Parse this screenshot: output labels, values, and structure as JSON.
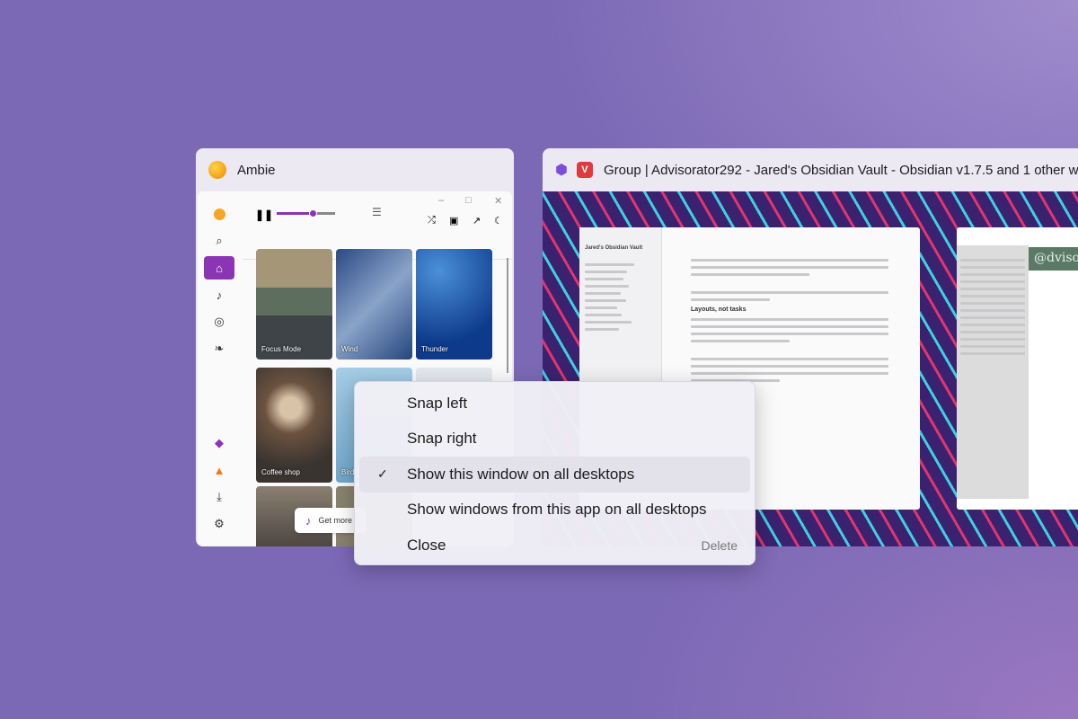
{
  "ambie": {
    "title": "Ambie",
    "tiles": [
      {
        "label": "Focus Mode"
      },
      {
        "label": "Wind"
      },
      {
        "label": "Thunder"
      },
      {
        "label": "Coffee shop"
      },
      {
        "label": "Bird"
      }
    ],
    "get_more": "Get more",
    "accent": "#8b35b5"
  },
  "obsidian": {
    "title": "Group | Advisorator292 - Jared's Obsidian Vault - Obsidian v1.7.5 and 1 other w",
    "vault": "Jared's Obsidian Vault",
    "heading": "Layouts, not tasks",
    "vivaldi_banner": "@dvisor"
  },
  "menu": {
    "items": [
      {
        "label": "Snap left"
      },
      {
        "label": "Snap right"
      },
      {
        "label": "Show this window on all desktops",
        "checked": true
      },
      {
        "label": "Show windows from this app on all desktops"
      },
      {
        "label": "Close",
        "accelerator": "Delete"
      }
    ]
  }
}
